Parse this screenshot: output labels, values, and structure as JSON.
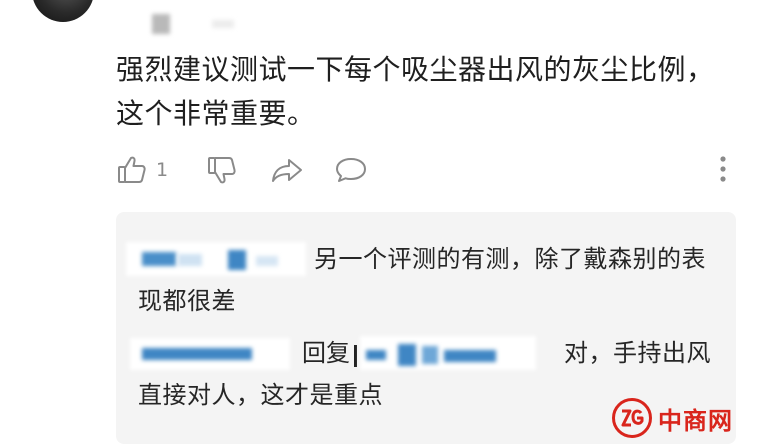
{
  "comment": {
    "text": "强烈建议测试一下每个吸尘器出风的灰尘比例，这个非常重要。"
  },
  "actions": {
    "like_count": "1"
  },
  "replies": [
    {
      "text": "另一个评测的有测，除了戴森别的表现都很差"
    },
    {
      "reply_word": "回复",
      "text": "对，手持出风直接对人，这才是重点"
    }
  ],
  "watermark": {
    "text": "中商网",
    "logo_text": "ZG"
  },
  "colors": {
    "brand_red": "#d9251c",
    "reply_bg": "#f4f4f4",
    "muted": "#8a8a8a"
  }
}
